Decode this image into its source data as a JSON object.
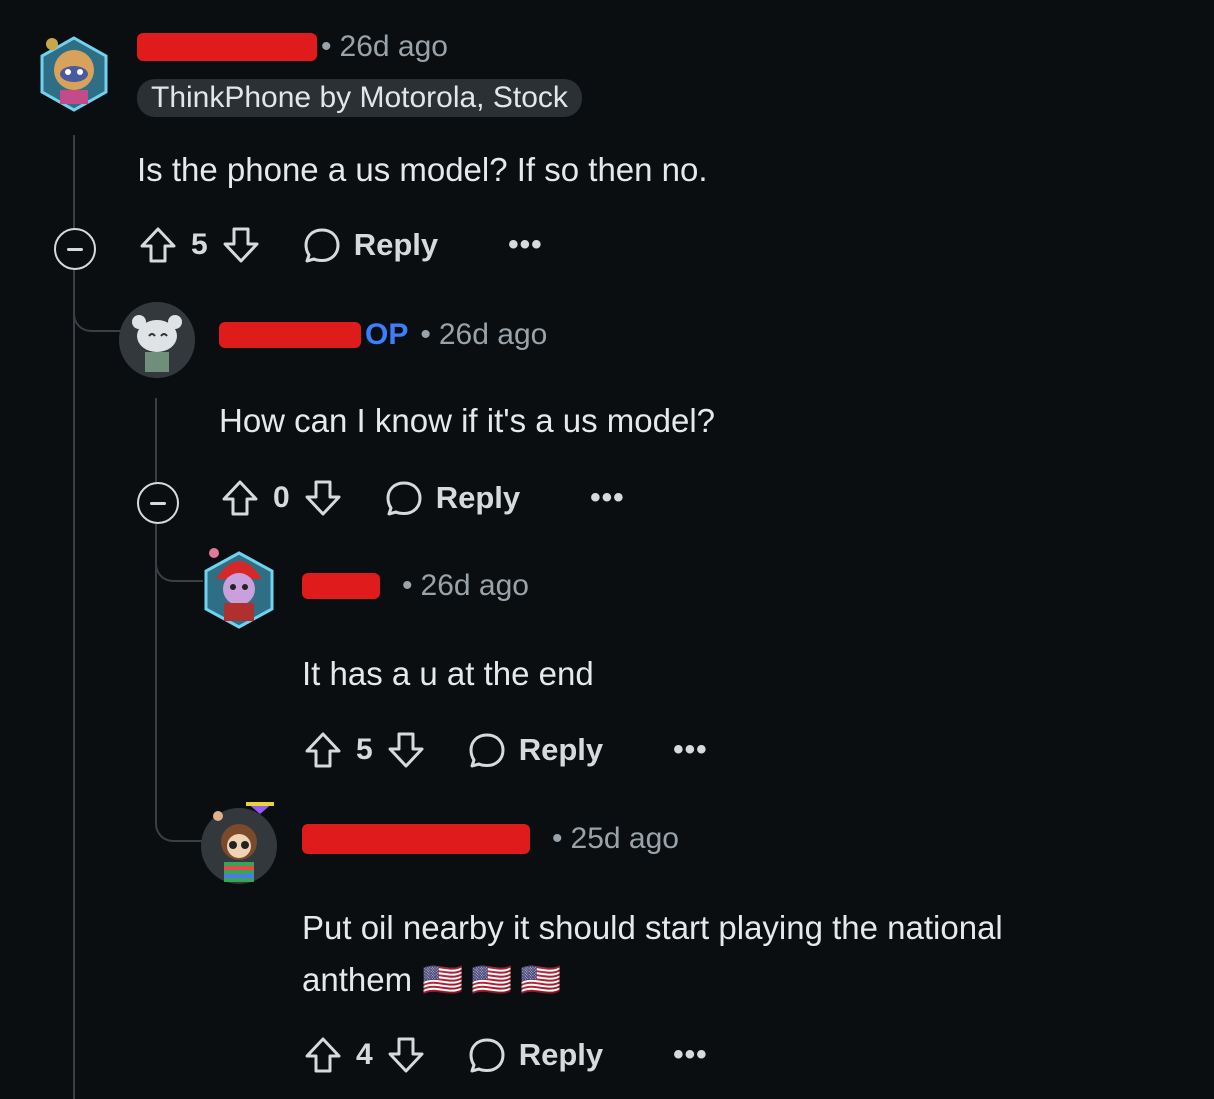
{
  "comments": [
    {
      "id": "c1",
      "time": "26d ago",
      "flair": "ThinkPhone by Motorola, Stock",
      "body": "Is the phone a us model? If so then no.",
      "score": "5",
      "reply_label": "Reply",
      "more_label": "•••"
    },
    {
      "id": "c2",
      "op_label": "OP",
      "time": "26d ago",
      "body": "How can I know if it's a us model?",
      "score": "0",
      "reply_label": "Reply",
      "more_label": "•••"
    },
    {
      "id": "c3",
      "time": "26d ago",
      "body": "It has a u at the end",
      "score": "5",
      "reply_label": "Reply",
      "more_label": "•••"
    },
    {
      "id": "c4",
      "time": "25d ago",
      "body_line1": "Put oil nearby it should start playing the national",
      "body_line2": "anthem",
      "emoji": [
        "🇺🇸",
        "🇺🇸",
        "🇺🇸"
      ],
      "score": "4",
      "reply_label": "Reply",
      "more_label": "•••"
    }
  ],
  "colors": {
    "background": "#0b0e10",
    "redaction": "#e01b1b",
    "op": "#3d7eff",
    "thread_line": "#3a3f44"
  }
}
